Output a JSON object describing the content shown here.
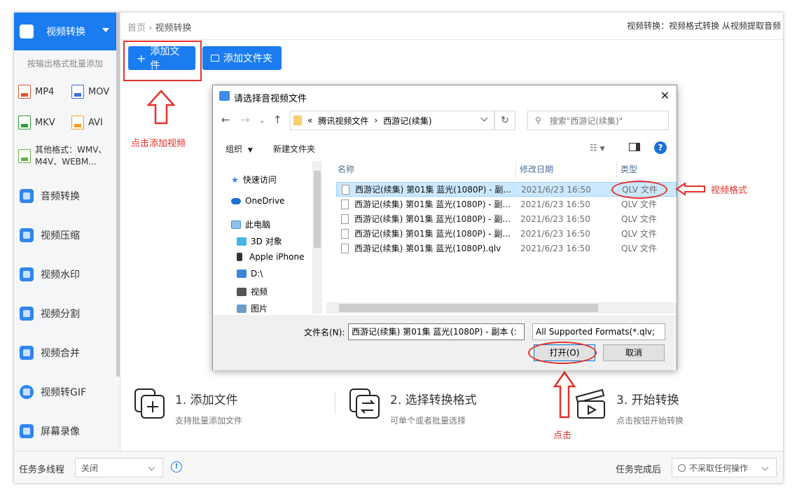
{
  "sidebar": {
    "header": "视频转换",
    "subtitle": "按输出格式批量添加",
    "formats": [
      "MP4",
      "MOV",
      "MKV",
      "AVI"
    ],
    "other_formats_line1": "其他格式：WMV、",
    "other_formats_line2": "M4V、WEBM...",
    "items": [
      "音频转换",
      "视频压缩",
      "视频水印",
      "视频分割",
      "视频合并",
      "视频转GIF",
      "屏幕录像"
    ]
  },
  "breadcrumb": {
    "home": "首页",
    "current": "视频转换"
  },
  "tagline": "视频转换：视频格式转换 从视频提取音频",
  "toolbar": {
    "add_file": "添加文件",
    "add_folder": "添加文件夹"
  },
  "annotations": {
    "add_video": "点击添加视频",
    "video_format": "视频格式",
    "click": "点击"
  },
  "steps": [
    {
      "title": "1. 添加文件",
      "sub": "支持批量添加文件"
    },
    {
      "title": "2. 选择转换格式",
      "sub": "可单个或者批量选择"
    },
    {
      "title": "3. 开始转换",
      "sub": "点击按钮开始转换"
    }
  ],
  "footer": {
    "multithread_label": "任务多线程",
    "multithread_value": "关闭",
    "after_done_label": "任务完成后",
    "after_done_value": "不采取任何操作"
  },
  "dialog": {
    "title": "请选择音视频文件",
    "address": [
      "«",
      "腾讯视频文件",
      "西游记(续集)"
    ],
    "search_placeholder": "搜索\"西游记(续集)\"",
    "organize": "组织",
    "new_folder": "新建文件夹",
    "tree": [
      "快速访问",
      "OneDrive",
      "此电脑",
      "3D 对象",
      "Apple iPhone",
      "D:\\",
      "视频",
      "图片"
    ],
    "columns": {
      "name": "名称",
      "date": "修改日期",
      "type": "类型"
    },
    "files": [
      {
        "name": "西游记(续集) 第01集 蓝光(1080P) - 副...",
        "date": "2021/6/23 16:50",
        "type": "QLV 文件"
      },
      {
        "name": "西游记(续集) 第01集 蓝光(1080P) - 副...",
        "date": "2021/6/23 16:50",
        "type": "QLV 文件"
      },
      {
        "name": "西游记(续集) 第01集 蓝光(1080P) - 副...",
        "date": "2021/6/23 16:50",
        "type": "QLV 文件"
      },
      {
        "name": "西游记(续集) 第01集 蓝光(1080P) - 副...",
        "date": "2021/6/23 16:50",
        "type": "QLV 文件"
      },
      {
        "name": "西游记(续集) 第01集 蓝光(1080P).qlv",
        "date": "2021/6/23 16:50",
        "type": "QLV 文件"
      }
    ],
    "filename_label": "文件名(N):",
    "filename_value": "西游记(续集) 第01集 蓝光(1080P) - 副本 (:",
    "filter_value": "All Supported Formats(*.qlv;",
    "open": "打开(O)",
    "cancel": "取消"
  },
  "colors": {
    "accent": "#1a7cf0",
    "annotation": "#e5312b",
    "selection": "#cce8ff"
  }
}
